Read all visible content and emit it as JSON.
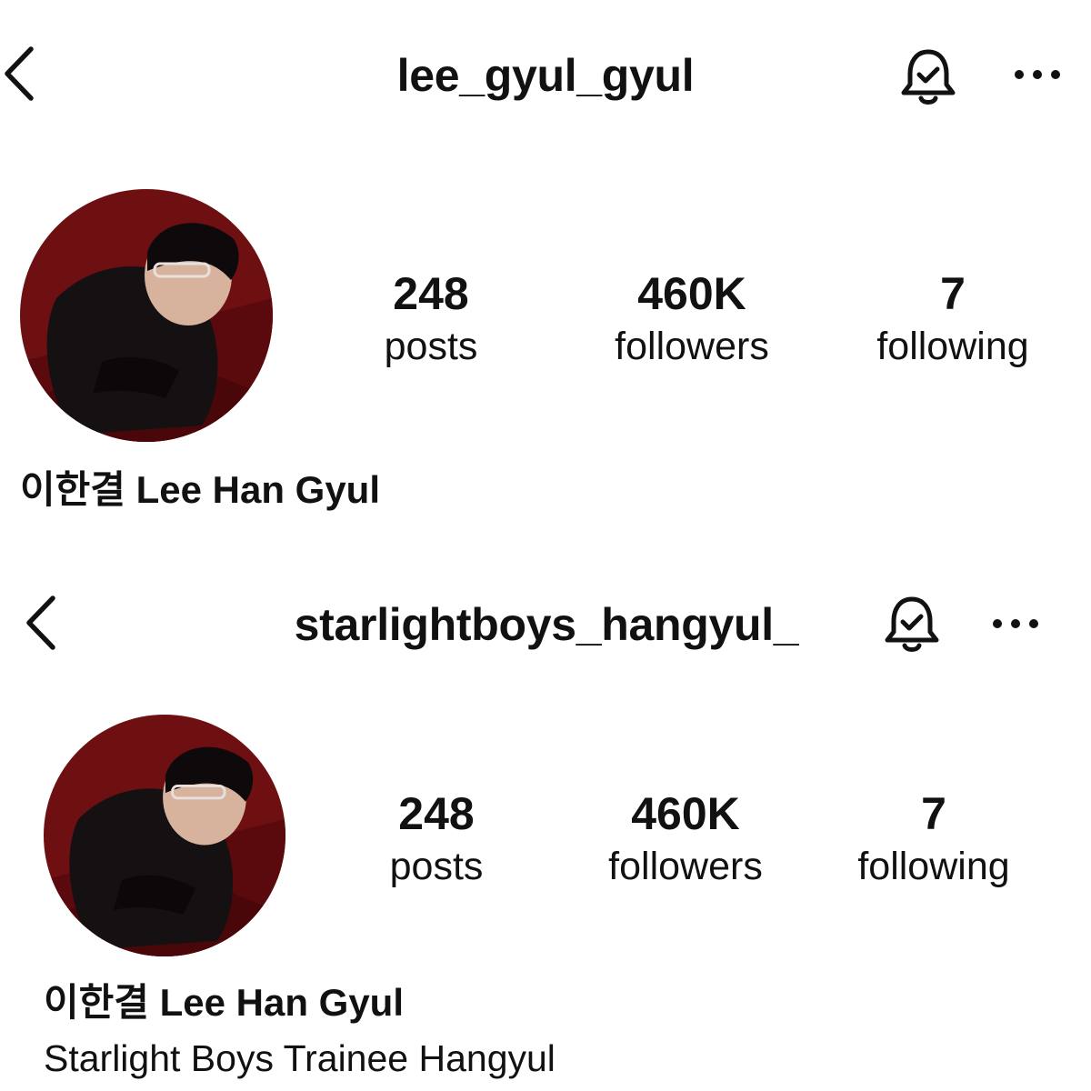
{
  "profiles": [
    {
      "username": "lee_gyul_gyul",
      "stats": [
        {
          "value": "248",
          "label": "posts"
        },
        {
          "value": "460K",
          "label": "followers"
        },
        {
          "value": "7",
          "label": "following"
        }
      ],
      "display_name": "이한결 Lee Han Gyul",
      "bio": ""
    },
    {
      "username": "starlightboys_hangyul_",
      "stats": [
        {
          "value": "248",
          "label": "posts"
        },
        {
          "value": "460K",
          "label": "followers"
        },
        {
          "value": "7",
          "label": "following"
        }
      ],
      "display_name": "이한결 Lee Han Gyul",
      "bio": "Starlight Boys Trainee Hangyul"
    }
  ],
  "icons": {
    "back": "chevron-left-icon",
    "notifications": "bell-check-icon",
    "more": "more-horizontal-icon"
  },
  "colors": {
    "avatar_background": "#6e0f12",
    "text": "#111111"
  }
}
